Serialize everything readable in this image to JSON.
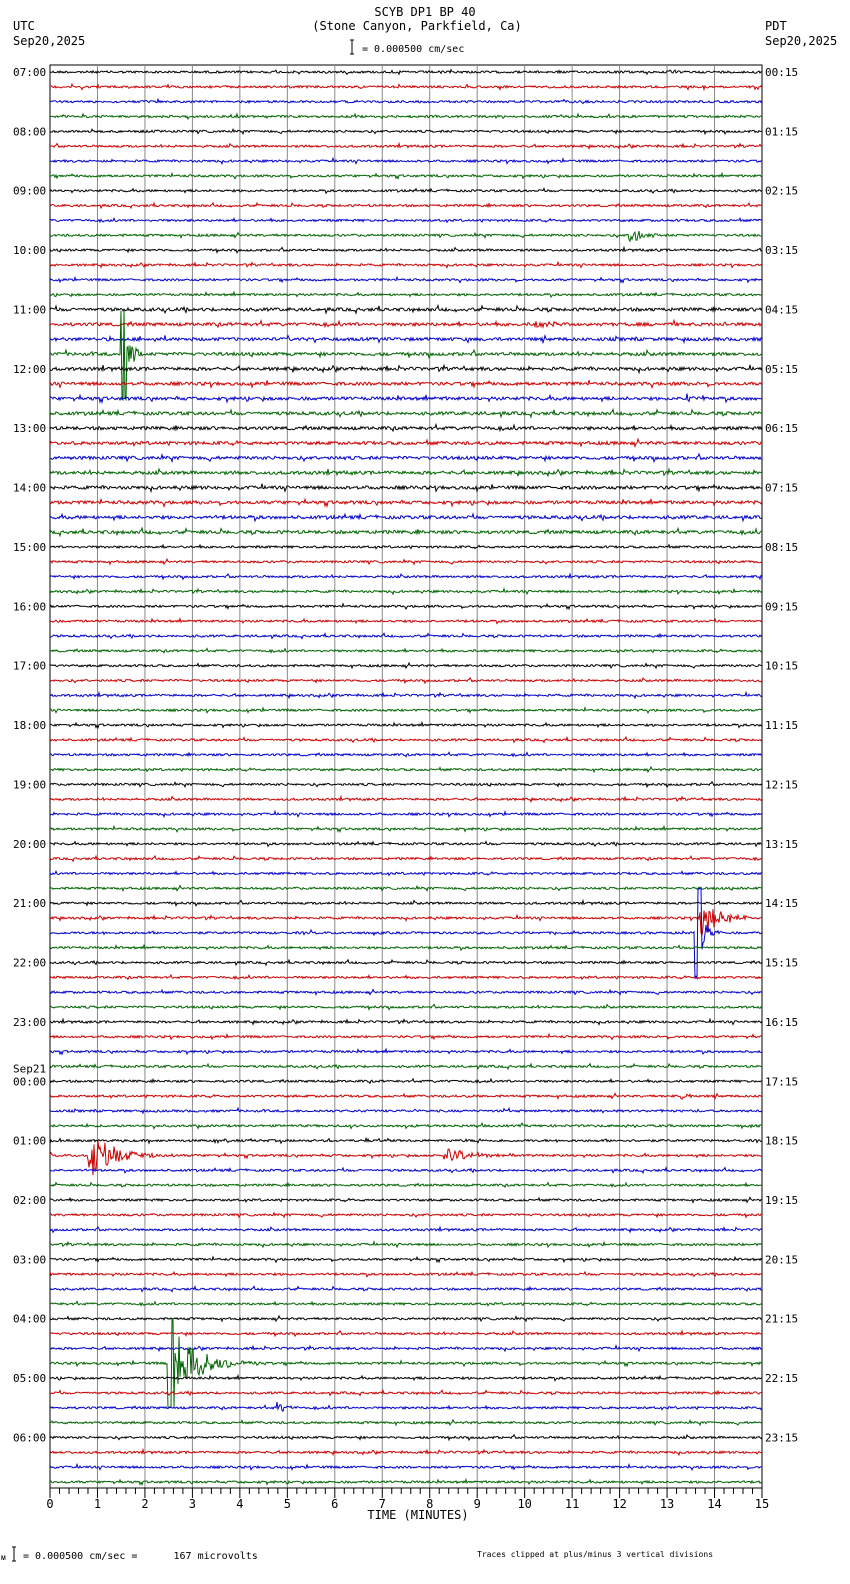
{
  "header": {
    "title": "SCYB DP1 BP 40",
    "subtitle": "(Stone Canyon, Parkfield, Ca)",
    "left_tz": "UTC",
    "left_date": "Sep20,2025",
    "right_tz": "PDT",
    "right_date": "Sep20,2025",
    "scale": "= 0.000500 cm/sec"
  },
  "footer": {
    "scale": "= 0.000500 cm/sec =      167 microvolts",
    "clip_note": "Traces clipped at plus/minus 3 vertical divisions",
    "corner_mark": "ᴍ"
  },
  "chart_data": {
    "type": "line",
    "title": "SCYB DP1 BP 40",
    "xlabel": "TIME (MINUTES)",
    "xlim": [
      0,
      15
    ],
    "x_ticks": [
      "0",
      "1",
      "2",
      "3",
      "4",
      "5",
      "6",
      "7",
      "8",
      "9",
      "10",
      "11",
      "12",
      "13",
      "14",
      "15"
    ],
    "traces_per_hour": 4,
    "trace_colors": [
      "#000000",
      "#cc0000",
      "#0000cc",
      "#006400"
    ],
    "left_labels": [
      "07:00",
      "08:00",
      "09:00",
      "10:00",
      "11:00",
      "12:00",
      "13:00",
      "14:00",
      "15:00",
      "16:00",
      "17:00",
      "18:00",
      "19:00",
      "20:00",
      "21:00",
      "22:00",
      "23:00",
      "00:00",
      "01:00",
      "02:00",
      "03:00",
      "04:00",
      "05:00",
      "06:00"
    ],
    "date_change": {
      "hour_index": 17,
      "label": "Sep21"
    },
    "right_labels": [
      "00:15",
      "01:15",
      "02:15",
      "03:15",
      "04:15",
      "05:15",
      "06:15",
      "07:15",
      "08:15",
      "09:15",
      "10:15",
      "11:15",
      "12:15",
      "13:15",
      "14:15",
      "15:15",
      "16:15",
      "17:15",
      "18:15",
      "19:15",
      "20:15",
      "21:15",
      "22:15",
      "23:15"
    ],
    "events": [
      {
        "trace": 11,
        "minute": 12.2,
        "amplitude": 1.2,
        "duration": 0.5
      },
      {
        "trace": 17,
        "minute": 10.2,
        "amplitude": 0.3,
        "duration": 1.0
      },
      {
        "trace": 19,
        "minute": 1.5,
        "amplitude": 3.0,
        "duration": 0.4,
        "clipped": true
      },
      {
        "trace": 22,
        "minute": 13.4,
        "amplitude": 0.5,
        "duration": 0.5
      },
      {
        "trace": 57,
        "minute": 13.7,
        "amplitude": 1.5,
        "duration": 1.0
      },
      {
        "trace": 58,
        "minute": 13.6,
        "amplitude": 3.0,
        "duration": 0.4,
        "clipped": true
      },
      {
        "trace": 69,
        "minute": 13.3,
        "amplitude": 0.4,
        "duration": 0.4
      },
      {
        "trace": 73,
        "minute": 0.8,
        "amplitude": 1.8,
        "duration": 1.3
      },
      {
        "trace": 73,
        "minute": 8.3,
        "amplitude": 0.6,
        "duration": 1.5
      },
      {
        "trace": 87,
        "minute": 2.5,
        "amplitude": 3.0,
        "duration": 1.5,
        "clipped": true
      },
      {
        "trace": 90,
        "minute": 4.8,
        "amplitude": 0.4,
        "duration": 0.4
      }
    ]
  }
}
